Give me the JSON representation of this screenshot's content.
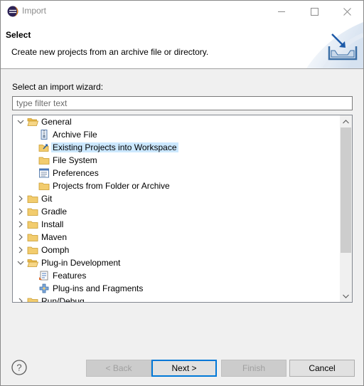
{
  "window": {
    "title": "Import",
    "minimize_glyph": "—",
    "maximize_glyph": "☐",
    "close_glyph": "✕"
  },
  "header": {
    "title": "Select",
    "description": "Create new projects from an archive file or directory."
  },
  "main": {
    "label": "Select an import wizard:",
    "filter_placeholder": "type filter text",
    "filter_value": ""
  },
  "tree": {
    "items": [
      {
        "label": "General",
        "level": 0,
        "expanded": true,
        "icon": "folder-open-icon"
      },
      {
        "label": "Archive File",
        "level": 1,
        "icon": "archive-file-icon"
      },
      {
        "label": "Existing Projects into Workspace",
        "level": 1,
        "icon": "existing-projects-icon",
        "selected": true
      },
      {
        "label": "File System",
        "level": 1,
        "icon": "folder-icon"
      },
      {
        "label": "Preferences",
        "level": 1,
        "icon": "preferences-icon"
      },
      {
        "label": "Projects from Folder or Archive",
        "level": 1,
        "icon": "folder-icon"
      },
      {
        "label": "Git",
        "level": 0,
        "expanded": false,
        "icon": "folder-icon"
      },
      {
        "label": "Gradle",
        "level": 0,
        "expanded": false,
        "icon": "folder-icon"
      },
      {
        "label": "Install",
        "level": 0,
        "expanded": false,
        "icon": "folder-icon"
      },
      {
        "label": "Maven",
        "level": 0,
        "expanded": false,
        "icon": "folder-icon"
      },
      {
        "label": "Oomph",
        "level": 0,
        "expanded": false,
        "icon": "folder-icon"
      },
      {
        "label": "Plug-in Development",
        "level": 0,
        "expanded": true,
        "icon": "folder-open-icon"
      },
      {
        "label": "Features",
        "level": 1,
        "icon": "features-icon"
      },
      {
        "label": "Plug-ins and Fragments",
        "level": 1,
        "icon": "plugins-icon"
      },
      {
        "label": "Run/Debug",
        "level": 0,
        "expanded": false,
        "icon": "folder-icon"
      }
    ]
  },
  "footer": {
    "back_label": "< Back",
    "next_label": "Next >",
    "finish_label": "Finish",
    "cancel_label": "Cancel",
    "help_glyph": "?"
  },
  "colors": {
    "selection": "#cce8ff",
    "default_button_border": "#0078d7",
    "folder": "#e8b84a"
  }
}
